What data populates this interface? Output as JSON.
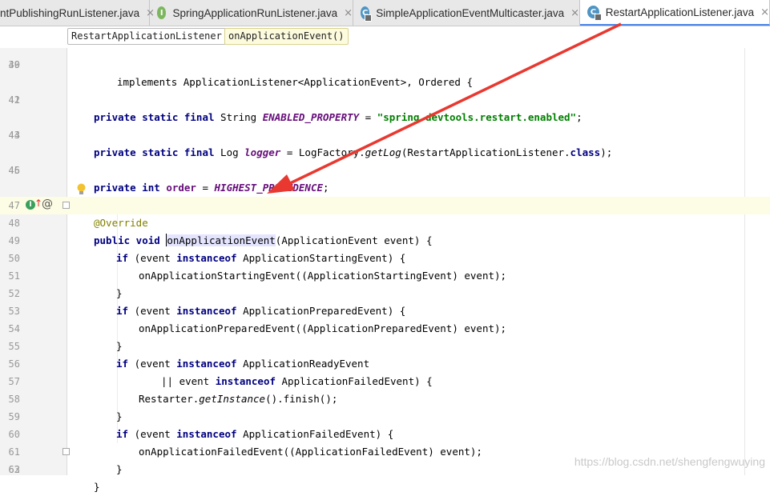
{
  "tabs": [
    {
      "label": "ntPublishingRunListener.java",
      "icon": "class-icon",
      "active": false,
      "closable": true
    },
    {
      "label": "SpringApplicationRunListener.java",
      "icon": "interface-icon",
      "icon_letter": "I",
      "active": false,
      "closable": true
    },
    {
      "label": "SimpleApplicationEventMulticaster.java",
      "icon": "class-icon",
      "icon_letter": "C",
      "active": false,
      "closable": true
    },
    {
      "label": "RestartApplicationListener.java",
      "icon": "class-icon",
      "icon_letter": "C",
      "active": true,
      "closable": true
    }
  ],
  "close_glyph": "×",
  "breadcrumb": [
    "RestartApplicationListener",
    "onApplicationEvent()"
  ],
  "line_numbers": [
    "39",
    "40",
    "41",
    "42",
    "43",
    "44",
    "45",
    "46",
    "47",
    "48",
    "49",
    "50",
    "51",
    "52",
    "53",
    "54",
    "55",
    "56",
    "57",
    "58",
    "59",
    "60",
    "61",
    "62",
    "63"
  ],
  "code": {
    "l39": "implements ApplicationListener<ApplicationEvent>, Ordered {",
    "l40_kw": "private static final",
    "l40_type": " String ",
    "l40_field": "ENABLED_PROPERTY",
    "l40_eq": " = ",
    "l40_str": "\"spring.devtools.restart.enabled\"",
    "l40_end": ";",
    "l42_kw": "private static final",
    "l42_type": " Log ",
    "l42_field": "logger",
    "l42_eq": " = LogFactory.",
    "l42_call": "getLog",
    "l42_arg": "(RestartApplicationListener.",
    "l42_cls": "class",
    "l42_end": ");",
    "l44_kw": "private int",
    "l44_field_name": " order",
    "l44_eq": " = ",
    "l44_const": "HIGHEST_PRECEDENCE",
    "l44_end": ";",
    "l46_ann": "@Override",
    "l47_kw": "public void",
    "l47_sp": " ",
    "l47_method": "onApplicationEvent",
    "l47_rest": "(ApplicationEvent event) {",
    "l48_if": "if",
    "l48_a": " (event ",
    "l48_io": "instanceof",
    "l48_b": " ApplicationStartingEvent) {",
    "l49": "onApplicationStartingEvent((ApplicationStartingEvent) event);",
    "brace": "}",
    "l51_if": "if",
    "l51_a": " (event ",
    "l51_io": "instanceof",
    "l51_b": " ApplicationPreparedEvent) {",
    "l52": "onApplicationPreparedEvent((ApplicationPreparedEvent) event);",
    "l54_if": "if",
    "l54_a": " (event ",
    "l54_io": "instanceof",
    "l54_b": " ApplicationReadyEvent",
    "l55_a": "|| event ",
    "l55_io": "instanceof",
    "l55_b": " ApplicationFailedEvent) {",
    "l56_a": "Restarter.",
    "l56_call": "getInstance",
    "l56_b": "().finish();",
    "l58_if": "if",
    "l58_a": " (event ",
    "l58_io": "instanceof",
    "l58_b": " ApplicationFailedEvent) {",
    "l59": "onApplicationFailedEvent((ApplicationFailedEvent) event);"
  },
  "gutter_icons": {
    "impl": "implements-icon",
    "impl_letter": "I",
    "override": "override-up-arrow-icon",
    "up_glyph": "↑",
    "annotation": "at-icon",
    "at_glyph": "@"
  },
  "watermark": "https://blog.csdn.net/shengfengwuying",
  "colors": {
    "keyword": "#000080",
    "string": "#008000",
    "field": "#660e7a",
    "annotation": "#808000",
    "arrow": "#e8382f"
  }
}
